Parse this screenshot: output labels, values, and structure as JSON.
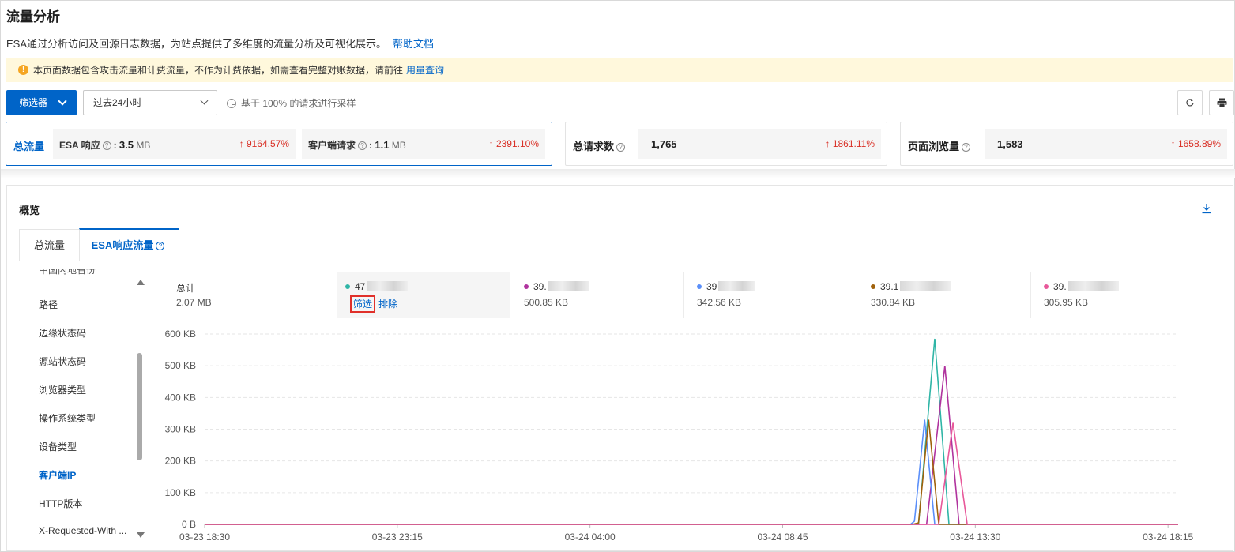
{
  "page": {
    "title": "流量分析",
    "description": "ESA通过分析访问及回源日志数据，为站点提供了多维度的流量分析及可视化展示。",
    "help_link": "帮助文档"
  },
  "notice": {
    "text": "本页面数据包含攻击流量和计费流量，不作为计费依据，如需查看完整对账数据，请前往",
    "link": "用量查询"
  },
  "toolbar": {
    "filter_label": "筛选器",
    "time_range": "过去24小时",
    "sample_note": "基于 100% 的请求进行采样",
    "refresh_icon": "refresh-icon",
    "print_icon": "print-icon"
  },
  "metrics": {
    "total_traffic": {
      "label": "总流量",
      "esa": {
        "label": "ESA 响应",
        "value": "3.5",
        "unit": "MB",
        "change": "↑ 9164.57%"
      },
      "client": {
        "label": "客户端请求",
        "value": "1.1",
        "unit": "MB",
        "change": "↑ 2391.10%"
      }
    },
    "requests": {
      "label": "总请求数",
      "value": "1,765",
      "change": "↑ 1861.11%"
    },
    "page_views": {
      "label": "页面浏览量",
      "value": "1,583",
      "change": "↑ 1658.89%"
    }
  },
  "overview": {
    "title": "概览",
    "tabs": [
      {
        "label": "总流量"
      },
      {
        "label": "ESA响应流量"
      }
    ],
    "side_items": [
      "中国内地省份",
      "路径",
      "边缘状态码",
      "源站状态码",
      "浏览器类型",
      "操作系统类型",
      "设备类型",
      "客户端IP",
      "HTTP版本",
      "X-Requested-With ..."
    ],
    "active_side_item": "客户端IP",
    "legend": {
      "total": {
        "label": "总计",
        "value": "2.07 MB"
      },
      "items": [
        {
          "prefix": "47",
          "value": "",
          "color": "#2fb5a6",
          "filter": "筛选",
          "exclude": "排除"
        },
        {
          "prefix": "39.",
          "value": "500.85 KB",
          "color": "#b0339e"
        },
        {
          "prefix": "39",
          "value": "342.56 KB",
          "color": "#5b8ff9"
        },
        {
          "prefix": "39.1",
          "value": "330.84 KB",
          "color": "#a0620c"
        },
        {
          "prefix": "39.",
          "value": "305.95 KB",
          "color": "#e8589a"
        }
      ]
    }
  },
  "chart_data": {
    "type": "line",
    "y_ticks": [
      "600 KB",
      "500 KB",
      "400 KB",
      "300 KB",
      "200 KB",
      "100 KB",
      "0 B"
    ],
    "x_ticks": [
      "03-23 18:30",
      "03-23 23:15",
      "03-24 04:00",
      "03-24 08:45",
      "03-24 13:30",
      "03-24 18:15"
    ],
    "ylim": [
      0,
      600
    ],
    "x_hours": [
      0,
      4.75,
      9.5,
      14.25,
      19,
      23.75
    ],
    "grid": true,
    "series": [
      {
        "color": "#2fb5a6",
        "points": [
          [
            0,
            0
          ],
          [
            17.6,
            0
          ],
          [
            18.0,
            585
          ],
          [
            18.35,
            0
          ],
          [
            24,
            0
          ]
        ]
      },
      {
        "color": "#b0339e",
        "points": [
          [
            0,
            0
          ],
          [
            17.8,
            0
          ],
          [
            18.25,
            500
          ],
          [
            18.6,
            0
          ],
          [
            24,
            0
          ]
        ]
      },
      {
        "color": "#5b8ff9",
        "points": [
          [
            0,
            0
          ],
          [
            17.4,
            0
          ],
          [
            17.5,
            10
          ],
          [
            17.75,
            330
          ],
          [
            18.0,
            0
          ],
          [
            24,
            0
          ]
        ]
      },
      {
        "color": "#a0620c",
        "points": [
          [
            0,
            0
          ],
          [
            17.45,
            0
          ],
          [
            17.6,
            5
          ],
          [
            17.85,
            330
          ],
          [
            18.1,
            0
          ],
          [
            24,
            0
          ]
        ]
      },
      {
        "color": "#e8589a",
        "points": [
          [
            0,
            0
          ],
          [
            18.1,
            0
          ],
          [
            18.45,
            320
          ],
          [
            18.8,
            0
          ],
          [
            24,
            0
          ]
        ]
      }
    ]
  }
}
